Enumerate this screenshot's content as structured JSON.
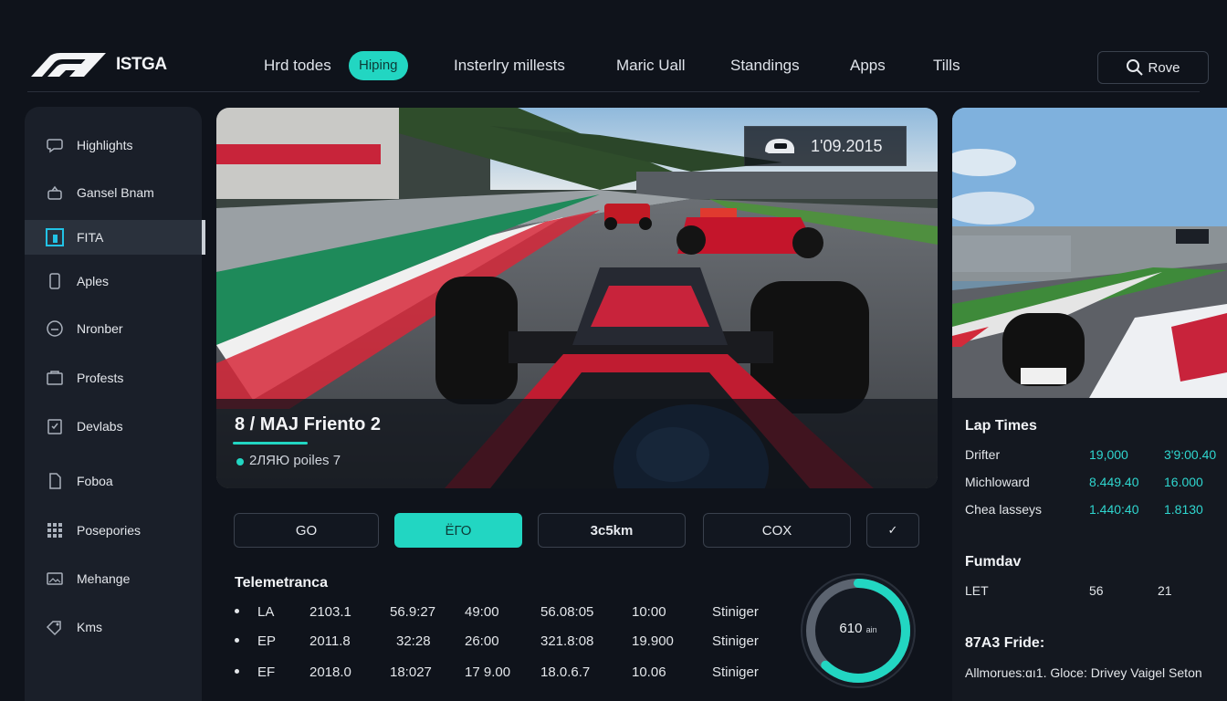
{
  "brand": {
    "logo_text": "ISTGA",
    "logo_icon": "f1-logo-icon"
  },
  "nav": {
    "items": [
      {
        "label": "Hrd todes"
      },
      {
        "label": "Hiping",
        "active": true
      },
      {
        "label": "Insterlry millests"
      },
      {
        "label": "Maric Uall"
      },
      {
        "label": "Standings"
      },
      {
        "label": "Apps"
      },
      {
        "label": "Tills"
      }
    ],
    "search_label": "Rove"
  },
  "sidebar": {
    "items": [
      {
        "label": "Highlights",
        "icon": "chat-bubble-icon"
      },
      {
        "label": "Gansel Bnam",
        "icon": "broadcast-icon"
      },
      {
        "label": "FITA",
        "icon": "square-grid-icon",
        "active": true
      },
      {
        "label": "Aples",
        "icon": "phone-icon"
      },
      {
        "label": "Nronber",
        "icon": "gauge-icon"
      },
      {
        "label": "Profests",
        "icon": "folder-icon"
      },
      {
        "label": "Devlabs",
        "icon": "document-check-icon"
      },
      {
        "label": "Foboa",
        "icon": "file-icon"
      },
      {
        "label": "Posepories",
        "icon": "grid-icon"
      },
      {
        "label": "Mehange",
        "icon": "image-icon"
      },
      {
        "label": "Kms",
        "icon": "tag-icon"
      }
    ]
  },
  "video": {
    "title": "8 / MAJ Friento 2",
    "subtitle": "2ЛЯЮ poiles 7",
    "badge_text": "1'09.2015"
  },
  "actions": [
    {
      "label": "GO"
    },
    {
      "label": "ЁГО",
      "primary": true
    },
    {
      "label": "3c5km"
    },
    {
      "label": "COX"
    },
    {
      "label": "✓"
    }
  ],
  "telemetry": {
    "title": "Telemetranca",
    "rows": [
      {
        "c1": "LA",
        "c2": "2103.1",
        "c3": "56.9:27",
        "c4": "49:00",
        "c5": "56.08:05",
        "c6": "10:00",
        "c7": "Stiniger"
      },
      {
        "c1": "EP",
        "c2": "2011.8",
        "c3": "32:28",
        "c4": "26:00",
        "c5": "321.8:08",
        "c6": "19.900",
        "c7": "Stiniger"
      },
      {
        "c1": "EF",
        "c2": "2018.0",
        "c3": "18:027",
        "c4": "17 9.00",
        "c5": "18.0.6.7",
        "c6": "10.06",
        "c7": "Stiniger"
      }
    ],
    "gauge": {
      "value_text": "610",
      "unit": "ain",
      "fill": 0.62
    }
  },
  "lap_times": {
    "title": "Lap Times",
    "rows": [
      {
        "name": "Drifter",
        "a": "19,000",
        "b": "3'9:00.40"
      },
      {
        "name": "Michloward",
        "a": "8.449.40",
        "b": "16.000"
      },
      {
        "name": "Chea lasseys",
        "a": "1.440:40",
        "b": "1.8130"
      }
    ]
  },
  "fundav": {
    "title": "Fumdav",
    "row": [
      "LET",
      "56",
      "21"
    ]
  },
  "f2": {
    "title": "87A3 Fride:",
    "text": "Allmorues:ɑı1. Gloce: Drivey  Vaigel Seton"
  },
  "colors": {
    "accent": "#22d6c2",
    "background": "#0f131b",
    "panel": "#1a1f29"
  }
}
